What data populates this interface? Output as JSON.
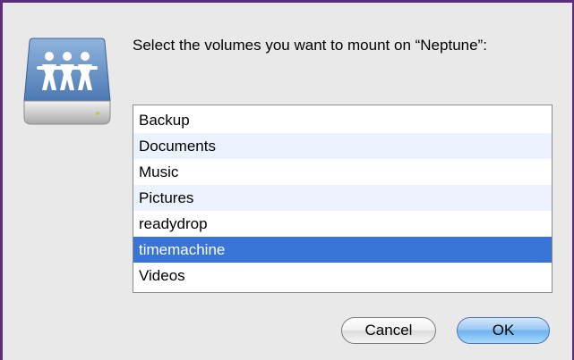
{
  "dialog": {
    "prompt": "Select the volumes you want to mount on “Neptune”:",
    "icon": "shared-network-drive-icon",
    "volumes": [
      {
        "label": "Backup",
        "selected": false
      },
      {
        "label": "Documents",
        "selected": false
      },
      {
        "label": "Music",
        "selected": false
      },
      {
        "label": "Pictures",
        "selected": false
      },
      {
        "label": "readydrop",
        "selected": false
      },
      {
        "label": "timemachine",
        "selected": true
      },
      {
        "label": "Videos",
        "selected": false
      }
    ],
    "cancel_label": "Cancel",
    "ok_label": "OK"
  },
  "colors": {
    "selection": "#3875d7",
    "alternate_row": "#edf3fe",
    "window_frame": "#5b2d7d",
    "default_button": "#6fb2ee"
  }
}
